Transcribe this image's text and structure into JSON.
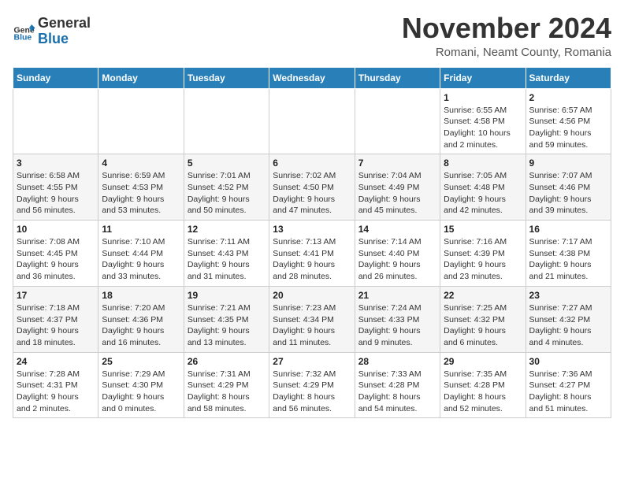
{
  "header": {
    "logo_general": "General",
    "logo_blue": "Blue",
    "month_title": "November 2024",
    "location": "Romani, Neamt County, Romania"
  },
  "weekdays": [
    "Sunday",
    "Monday",
    "Tuesday",
    "Wednesday",
    "Thursday",
    "Friday",
    "Saturday"
  ],
  "weeks": [
    [
      {
        "day": "",
        "info": ""
      },
      {
        "day": "",
        "info": ""
      },
      {
        "day": "",
        "info": ""
      },
      {
        "day": "",
        "info": ""
      },
      {
        "day": "",
        "info": ""
      },
      {
        "day": "1",
        "info": "Sunrise: 6:55 AM\nSunset: 4:58 PM\nDaylight: 10 hours\nand 2 minutes."
      },
      {
        "day": "2",
        "info": "Sunrise: 6:57 AM\nSunset: 4:56 PM\nDaylight: 9 hours\nand 59 minutes."
      }
    ],
    [
      {
        "day": "3",
        "info": "Sunrise: 6:58 AM\nSunset: 4:55 PM\nDaylight: 9 hours\nand 56 minutes."
      },
      {
        "day": "4",
        "info": "Sunrise: 6:59 AM\nSunset: 4:53 PM\nDaylight: 9 hours\nand 53 minutes."
      },
      {
        "day": "5",
        "info": "Sunrise: 7:01 AM\nSunset: 4:52 PM\nDaylight: 9 hours\nand 50 minutes."
      },
      {
        "day": "6",
        "info": "Sunrise: 7:02 AM\nSunset: 4:50 PM\nDaylight: 9 hours\nand 47 minutes."
      },
      {
        "day": "7",
        "info": "Sunrise: 7:04 AM\nSunset: 4:49 PM\nDaylight: 9 hours\nand 45 minutes."
      },
      {
        "day": "8",
        "info": "Sunrise: 7:05 AM\nSunset: 4:48 PM\nDaylight: 9 hours\nand 42 minutes."
      },
      {
        "day": "9",
        "info": "Sunrise: 7:07 AM\nSunset: 4:46 PM\nDaylight: 9 hours\nand 39 minutes."
      }
    ],
    [
      {
        "day": "10",
        "info": "Sunrise: 7:08 AM\nSunset: 4:45 PM\nDaylight: 9 hours\nand 36 minutes."
      },
      {
        "day": "11",
        "info": "Sunrise: 7:10 AM\nSunset: 4:44 PM\nDaylight: 9 hours\nand 33 minutes."
      },
      {
        "day": "12",
        "info": "Sunrise: 7:11 AM\nSunset: 4:43 PM\nDaylight: 9 hours\nand 31 minutes."
      },
      {
        "day": "13",
        "info": "Sunrise: 7:13 AM\nSunset: 4:41 PM\nDaylight: 9 hours\nand 28 minutes."
      },
      {
        "day": "14",
        "info": "Sunrise: 7:14 AM\nSunset: 4:40 PM\nDaylight: 9 hours\nand 26 minutes."
      },
      {
        "day": "15",
        "info": "Sunrise: 7:16 AM\nSunset: 4:39 PM\nDaylight: 9 hours\nand 23 minutes."
      },
      {
        "day": "16",
        "info": "Sunrise: 7:17 AM\nSunset: 4:38 PM\nDaylight: 9 hours\nand 21 minutes."
      }
    ],
    [
      {
        "day": "17",
        "info": "Sunrise: 7:18 AM\nSunset: 4:37 PM\nDaylight: 9 hours\nand 18 minutes."
      },
      {
        "day": "18",
        "info": "Sunrise: 7:20 AM\nSunset: 4:36 PM\nDaylight: 9 hours\nand 16 minutes."
      },
      {
        "day": "19",
        "info": "Sunrise: 7:21 AM\nSunset: 4:35 PM\nDaylight: 9 hours\nand 13 minutes."
      },
      {
        "day": "20",
        "info": "Sunrise: 7:23 AM\nSunset: 4:34 PM\nDaylight: 9 hours\nand 11 minutes."
      },
      {
        "day": "21",
        "info": "Sunrise: 7:24 AM\nSunset: 4:33 PM\nDaylight: 9 hours\nand 9 minutes."
      },
      {
        "day": "22",
        "info": "Sunrise: 7:25 AM\nSunset: 4:32 PM\nDaylight: 9 hours\nand 6 minutes."
      },
      {
        "day": "23",
        "info": "Sunrise: 7:27 AM\nSunset: 4:32 PM\nDaylight: 9 hours\nand 4 minutes."
      }
    ],
    [
      {
        "day": "24",
        "info": "Sunrise: 7:28 AM\nSunset: 4:31 PM\nDaylight: 9 hours\nand 2 minutes."
      },
      {
        "day": "25",
        "info": "Sunrise: 7:29 AM\nSunset: 4:30 PM\nDaylight: 9 hours\nand 0 minutes."
      },
      {
        "day": "26",
        "info": "Sunrise: 7:31 AM\nSunset: 4:29 PM\nDaylight: 8 hours\nand 58 minutes."
      },
      {
        "day": "27",
        "info": "Sunrise: 7:32 AM\nSunset: 4:29 PM\nDaylight: 8 hours\nand 56 minutes."
      },
      {
        "day": "28",
        "info": "Sunrise: 7:33 AM\nSunset: 4:28 PM\nDaylight: 8 hours\nand 54 minutes."
      },
      {
        "day": "29",
        "info": "Sunrise: 7:35 AM\nSunset: 4:28 PM\nDaylight: 8 hours\nand 52 minutes."
      },
      {
        "day": "30",
        "info": "Sunrise: 7:36 AM\nSunset: 4:27 PM\nDaylight: 8 hours\nand 51 minutes."
      }
    ]
  ]
}
